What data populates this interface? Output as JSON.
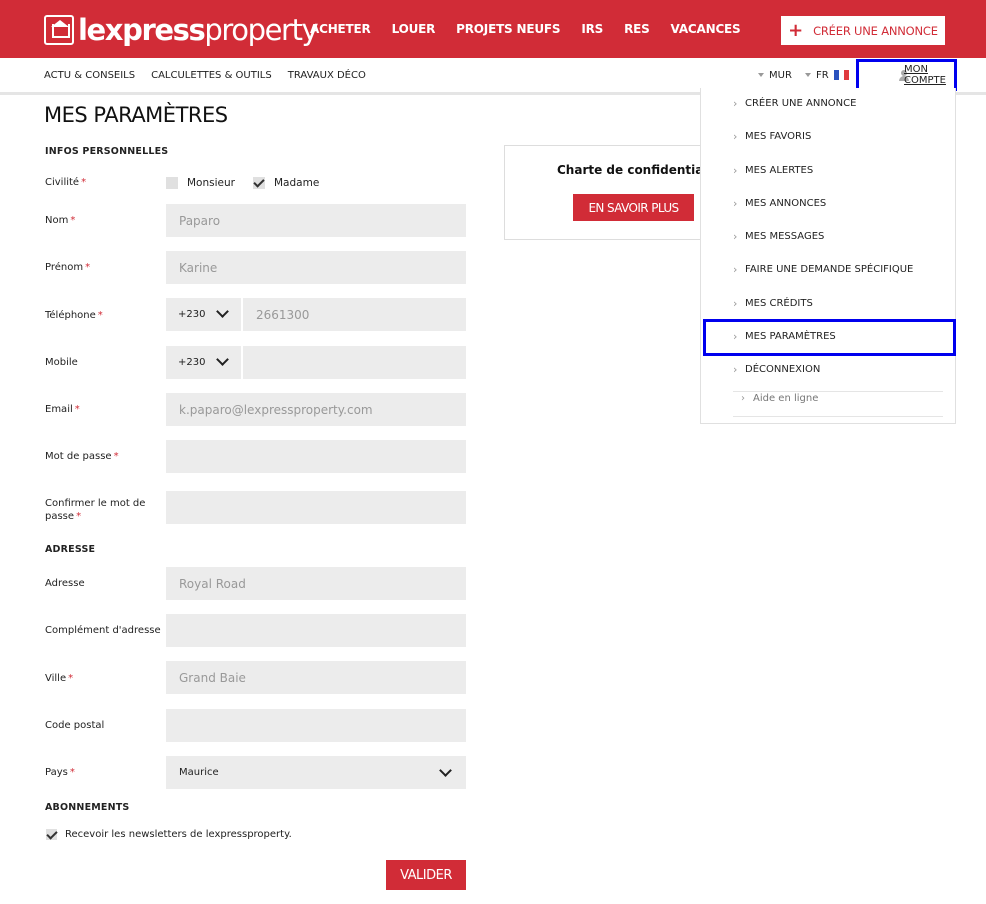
{
  "brand": {
    "logo_bold": "lexpress",
    "logo_light": "property"
  },
  "main_nav": [
    "ACHETER",
    "LOUER",
    "PROJETS NEUFS",
    "IRS",
    "RES",
    "VACANCES"
  ],
  "create_button": "CRÉER UNE ANNONCE",
  "sub_nav": [
    "ACTU & CONSEILS",
    "CALCULETTES & OUTILS",
    "TRAVAUX DÉCO"
  ],
  "currency": "MUR",
  "language": "FR",
  "account_label": "MON COMPTE",
  "dropdown": {
    "items": [
      "CRÉER UNE ANNONCE",
      "MES FAVORIS",
      "MES ALERTES",
      "MES ANNONCES",
      "MES MESSAGES",
      "FAIRE UNE DEMANDE SPÉCIFIQUE",
      "MES CRÉDITS",
      "MES PARAMÈTRES",
      "DÉCONNEXION"
    ],
    "help": "Aide en ligne"
  },
  "page_title": "MES PARAMÈTRES",
  "sections": {
    "personal": "INFOS PERSONNELLES",
    "address": "ADRESSE",
    "subscriptions": "ABONNEMENTS"
  },
  "form": {
    "civility_label": "Civilité",
    "civility_options": [
      "Monsieur",
      "Madame"
    ],
    "civility_selected": "Madame",
    "nom_label": "Nom",
    "nom_value": "Paparo",
    "prenom_label": "Prénom",
    "prenom_value": "Karine",
    "telephone_label": "Téléphone",
    "telephone_code": "+230",
    "telephone_value": "2661300",
    "mobile_label": "Mobile",
    "mobile_code": "+230",
    "mobile_value": "",
    "email_label": "Email",
    "email_value": "k.paparo@lexpressproperty.com",
    "password_label": "Mot de passe",
    "confirm_label_1": "Confirmer le mot de",
    "confirm_label_2": "passe",
    "address_label": "Adresse",
    "address_value": "Royal Road",
    "complement_label": "Complément d'adresse",
    "city_label": "Ville",
    "city_value": "Grand Baie",
    "postal_label": "Code postal",
    "country_label": "Pays",
    "country_value": "Maurice",
    "newsletter_label": "Recevoir les newsletters de lexpressproperty.",
    "newsletter_checked": true,
    "submit": "VALIDER",
    "required_mark": "*"
  },
  "privacy": {
    "title": "Charte de confidentialité",
    "button": "EN SAVOIR PLUS"
  },
  "colors": {
    "brand_red": "#d12c37",
    "highlight_blue": "#0000ee",
    "field_bg": "#ececec"
  }
}
